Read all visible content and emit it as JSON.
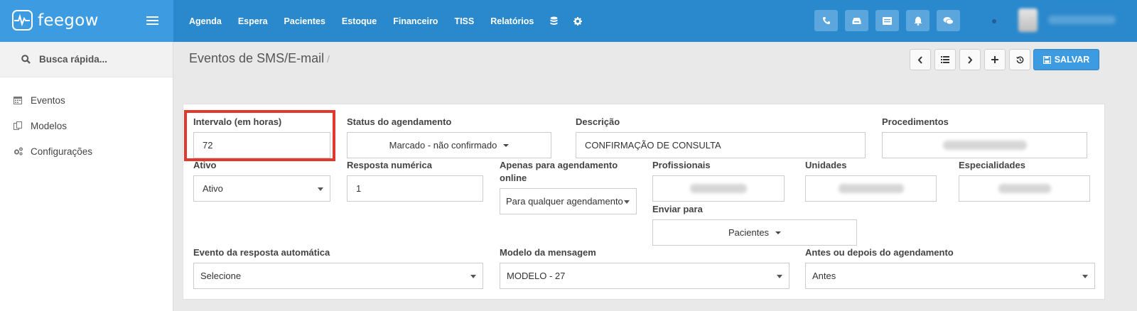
{
  "app": {
    "logo_text": "feegow"
  },
  "nav": {
    "items": [
      "Agenda",
      "Espera",
      "Pacientes",
      "Estoque",
      "Financeiro",
      "TISS",
      "Relatórios"
    ]
  },
  "topbar_icons": [
    "phone-icon",
    "inbox-icon",
    "list-icon",
    "bell-icon",
    "chat-icon"
  ],
  "search": {
    "label": "Busca rápida..."
  },
  "sidebar": {
    "items": [
      {
        "label": "Eventos",
        "icon": "calendar-icon"
      },
      {
        "label": "Modelos",
        "icon": "copy-icon"
      },
      {
        "label": "Configurações",
        "icon": "cogs-icon"
      }
    ]
  },
  "header": {
    "title": "Eventos de SMS/E-mail",
    "separator": "/",
    "save_label": "SALVAR"
  },
  "form": {
    "intervalo": {
      "label": "Intervalo (em horas)",
      "value": "72"
    },
    "status": {
      "label": "Status do agendamento",
      "value": "Marcado - não confirmado"
    },
    "descricao": {
      "label": "Descrição",
      "value": "CONFIRMAÇÃO DE CONSULTA"
    },
    "procedimentos": {
      "label": "Procedimentos"
    },
    "ativo": {
      "label": "Ativo",
      "value": "Ativo"
    },
    "resposta": {
      "label": "Resposta numérica",
      "value": "1"
    },
    "apenas": {
      "label_line1": "Apenas para agendamento",
      "label_line2": "online",
      "value": "Para qualquer agendamento"
    },
    "profissionais": {
      "label": "Profissionais"
    },
    "unidades": {
      "label": "Unidades"
    },
    "especialidades": {
      "label": "Especialidades"
    },
    "enviar": {
      "label": "Enviar para",
      "value": "Pacientes"
    },
    "evento_resp": {
      "label": "Evento da resposta automática",
      "value": "Selecione"
    },
    "modelo": {
      "label": "Modelo da mensagem",
      "value": "MODELO - 27"
    },
    "antes": {
      "label": "Antes ou depois do agendamento",
      "value": "Antes"
    }
  },
  "colors": {
    "topbar": "#2a88cc",
    "logo_area": "#3d9be2",
    "save_button": "#3d9be2",
    "highlight": "#e03a2f"
  }
}
